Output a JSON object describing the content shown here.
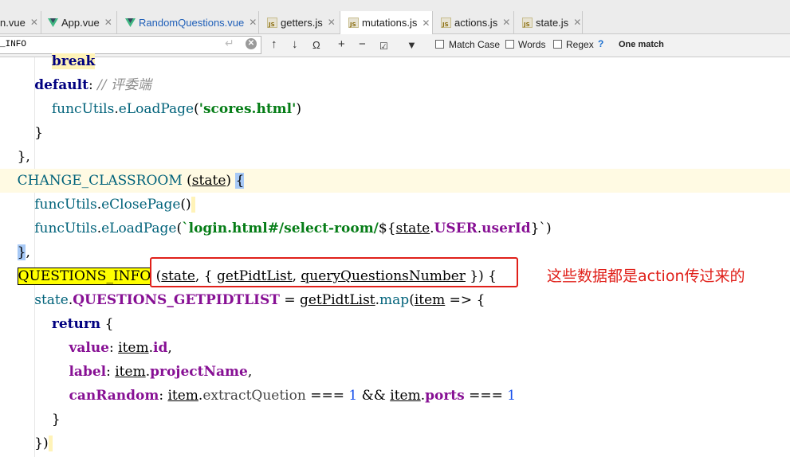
{
  "tabs": [
    {
      "label": "n.vue",
      "type": "vue"
    },
    {
      "label": "App.vue",
      "type": "vue"
    },
    {
      "label": "RandomQuestions.vue",
      "type": "vue"
    },
    {
      "label": "getters.js",
      "type": "js"
    },
    {
      "label": "mutations.js",
      "type": "js",
      "active": true
    },
    {
      "label": "actions.js",
      "type": "js"
    },
    {
      "label": "state.js",
      "type": "js"
    }
  ],
  "search": {
    "value": "_INFO",
    "match_case_label": "Match Case",
    "words_label": "Words",
    "regex_label": "Regex",
    "help": "?",
    "result": "One match"
  },
  "code": {
    "l1_kw": "break",
    "l2_kw": "default",
    "l2_cm": "// 评委端",
    "l3_obj": "funcUtils",
    "l3_fn": "eLoadPage",
    "l3_str": "'scores.html'",
    "l6_name": "CHANGE_CLASSROOM",
    "l6_param": "state",
    "l7_obj": "funcUtils",
    "l7_fn": "eClosePage",
    "l8_obj": "funcUtils",
    "l8_fn": "eLoadPage",
    "l8_str": "`login.html#/select-room/",
    "l8_var": "state",
    "l8_prop1": "USER",
    "l8_prop2": "userId",
    "l10_name": "QUESTIONS_INFO",
    "l10_p1": "state",
    "l10_p2": "getPidtList",
    "l10_p3": "queryQuestionsNumber",
    "l11_var": "state",
    "l11_prop": "QUESTIONS_GETPIDTLIST",
    "l11_list": "getPidtList",
    "l11_fn": "map",
    "l11_arg": "item",
    "l12_kw": "return",
    "l13_key": "value",
    "l13_obj": "item",
    "l13_prop": "id",
    "l14_key": "label",
    "l14_obj": "item",
    "l14_prop": "projectName",
    "l15_key": "canRandom",
    "l15_obj": "item",
    "l15_prop1": "extractQuetion",
    "l15_num1": "1",
    "l15_obj2": "item",
    "l15_prop2": "ports",
    "l15_num2": "1"
  },
  "annotation": "这些数据都是action传过来的",
  "colors": {
    "annotation": "#e0201a",
    "search_highlight": "#ffff00"
  }
}
